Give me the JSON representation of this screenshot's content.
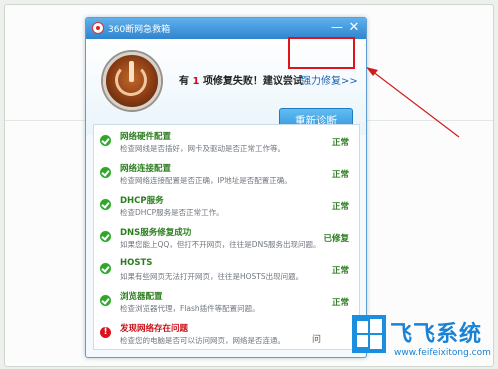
{
  "window": {
    "title": "360断网急救箱",
    "min_symbol": "—",
    "close_symbol": "✕"
  },
  "header": {
    "fail_prefix": "有",
    "fail_count": "1",
    "fail_suffix": "项修复失败！建议尝试",
    "repair_link": "强力修复>>",
    "rediagnose_button": "重新诊断"
  },
  "checks": [
    {
      "title": "网络硬件配置",
      "desc": "检查网线是否插好，网卡及驱动是否正常工作等。",
      "status": "正常",
      "state": "ok"
    },
    {
      "title": "网络连接配置",
      "desc": "检查网络连接配置是否正确，IP地址是否配置正确。",
      "status": "正常",
      "state": "ok"
    },
    {
      "title": "DHCP服务",
      "desc": "检查DHCP服务是否正常工作。",
      "status": "正常",
      "state": "ok"
    },
    {
      "title": "DNS服务修复成功",
      "desc": "如果您能上QQ，但打不开网页，往往是DNS服务出现问题。",
      "status": "已修复",
      "state": "ok"
    },
    {
      "title": "HOSTS",
      "desc": "如果有些网页无法打开网页，往往是HOSTS出现问题。",
      "status": "正常",
      "state": "ok"
    },
    {
      "title": "浏览器配置",
      "desc": "检查浏览器代理，Flash插件等配置问题。",
      "status": "正常",
      "state": "ok"
    },
    {
      "title": "发现网络存在问题",
      "desc": "检查您的电脑是否可以访问网页，网络是否连通。",
      "status": "",
      "state": "error"
    }
  ],
  "partial_button": "问",
  "watermark": {
    "text": "飞飞系统",
    "url": "www.feifeixitong.com"
  },
  "colors": {
    "accent": "#2f84cf",
    "ok": "#2c7d1f",
    "error": "#c8101a",
    "highlight": "#e0121b"
  }
}
